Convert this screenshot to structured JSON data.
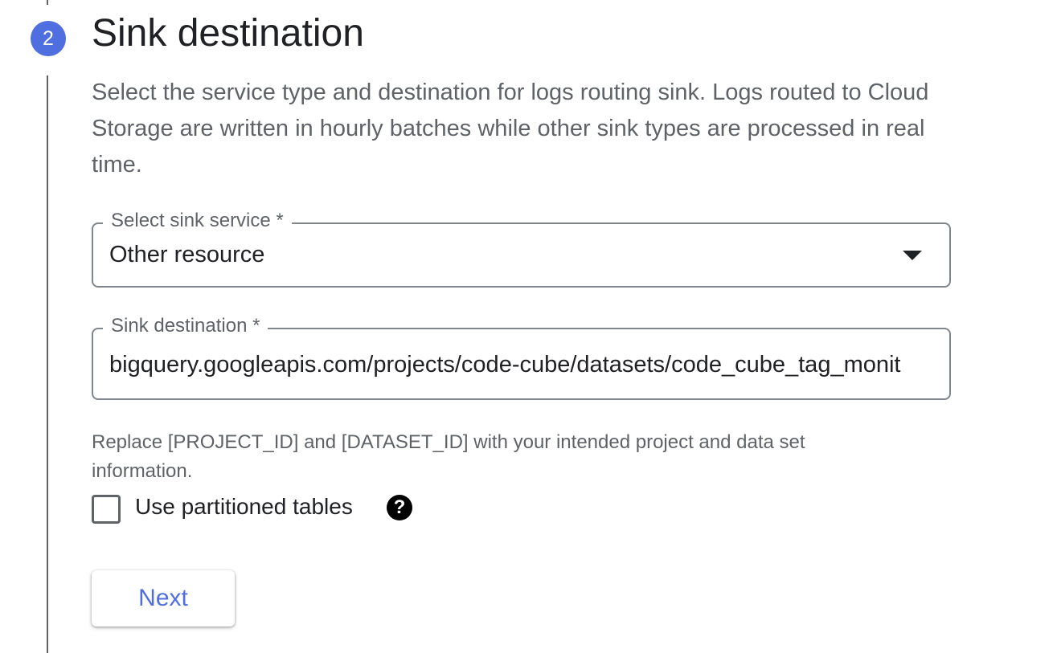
{
  "step": {
    "number": "2",
    "title": "Sink destination",
    "description": "Select the service type and destination for logs routing sink. Logs routed to Cloud Storage are written in hourly batches while other sink types are processed in real time."
  },
  "sink_service": {
    "label": "Select sink service *",
    "value": "Other resource",
    "icon": "dropdown-arrow-icon"
  },
  "sink_destination": {
    "label": "Sink destination *",
    "value": "bigquery.googleapis.com/projects/code-cube/datasets/code_cube_tag_monit"
  },
  "hint": "Replace [PROJECT_ID] and [DATASET_ID] with your intended project and data set information.",
  "partitioned": {
    "label": "Use partitioned tables",
    "checked": false,
    "help_icon": "help-icon",
    "help_glyph": "?"
  },
  "next_button": "Next",
  "colors": {
    "accent": "#4f6fe0",
    "text_primary": "#202124",
    "text_secondary": "#5f6368",
    "border": "#80868b"
  }
}
